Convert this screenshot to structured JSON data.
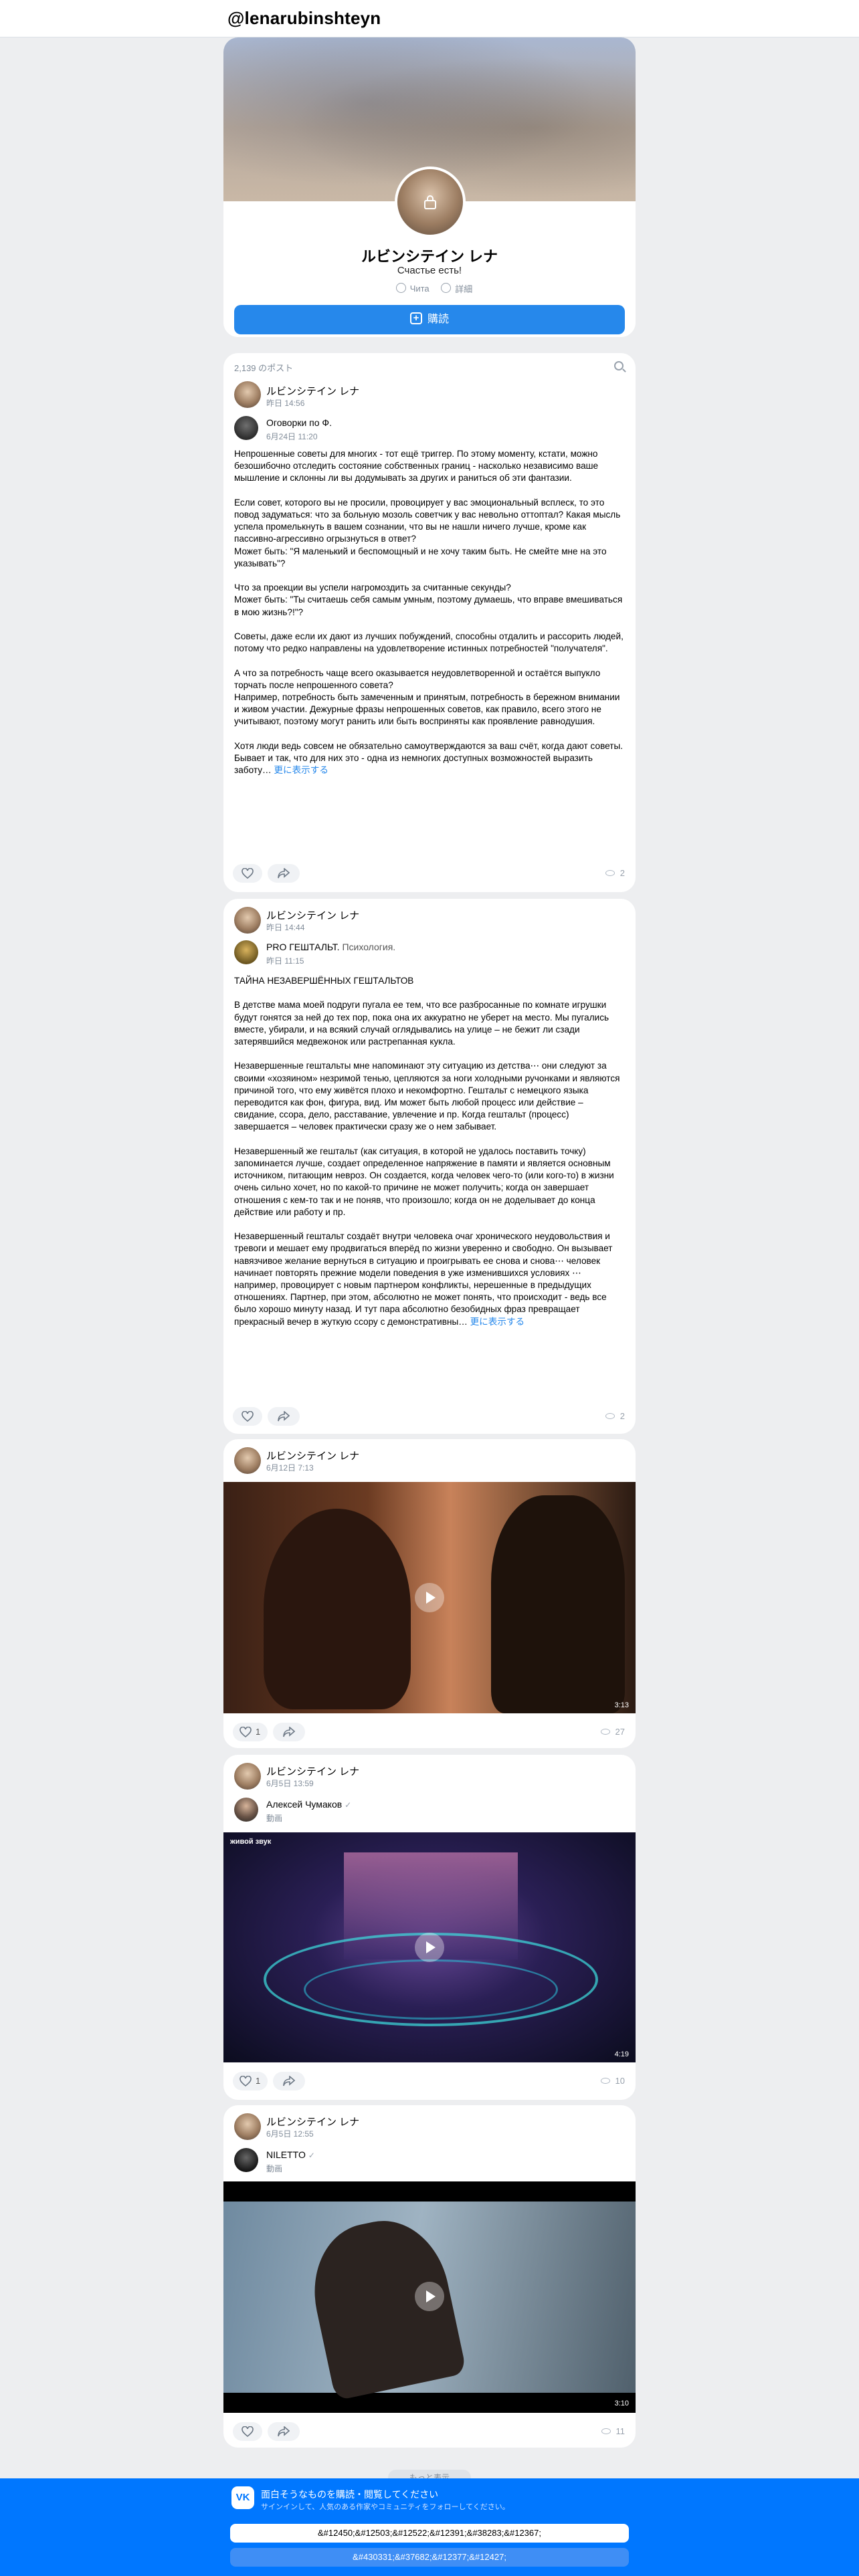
{
  "header": {
    "handle": "@lenarubinshteyn"
  },
  "profile": {
    "name": "ルビンシテイン レナ",
    "status": "Счастье есть!",
    "city": "Чита",
    "details": "詳細",
    "subscribe": "購読"
  },
  "wall": {
    "count": "2,139 のポスト"
  },
  "posts": [
    {
      "author": "ルビンシテイン レナ",
      "date": "昨日 14:56",
      "repost_name": "Оговорки по Ф.",
      "repost_date": "6月24日 11:20",
      "text": "Непрошенные советы для многих - тот ещё триггер. По этому моменту, кстати, можно безошибочно отследить состояние собственных границ - насколько независимо ваше мышление и склонны ли вы додумывать за других и раниться об эти фантазии.\n\nЕсли совет, которого вы не просили, провоцирует у вас эмоциональный всплеск, то это повод задуматься: что за больную мозоль советчик у вас невольно оттоптал? Какая мысль успела промелькнуть в вашем сознании, что вы не нашли ничего лучше, кроме как пассивно-агрессивно огрызнуться в ответ?\nМожет быть: \"Я маленький и беспомощный и не хочу таким быть. Не смейте мне на это указывать\"?\n\nЧто за проекции вы успели нагромоздить за считанные секунды?\nМожет быть: \"Ты считаешь себя самым умным, поэтому думаешь, что вправе вмешиваться в мою жизнь?!\"?\n\nСоветы, даже если их дают из лучших побуждений, способны отдалить и рассорить людей, потому что редко направлены на удовлетворение истинных потребностей \"получателя\".\n\nА что за потребность чаще всего оказывается неудовлетворенной и остаётся выпукло торчать после непрошенного совета?\nНапример, потребность быть замеченным и принятым, потребность в бережном внимании и живом участии. Дежурные фразы непрошенных советов, как правило, всего этого не учитывают, поэтому могут ранить или быть восприняты как проявление равнодушия.\n\nХотя люди ведь совсем не обязательно самоутверждаются за ваш счёт, когда дают советы. Бывает и так, что для них это - одна из немногих доступных возможностей выразить заботу…",
      "more": "更に表示する",
      "likes": "",
      "views": "2"
    },
    {
      "author": "ルビンシテイン レナ",
      "date": "昨日 14:44",
      "repost_name": "PRO ГЕШТАЛЬТ.",
      "repost_name2": "Психология.",
      "repost_date": "昨日 11:15",
      "text": "ТАЙНА НЕЗАВЕРШЁННЫХ ГЕШТАЛЬТОВ\n\nВ детстве мама моей подруги пугала ее тем, что все разбросанные по комнате игрушки будут гонятся за ней до тех пор, пока она их аккуратно не уберет на место. Мы пугались вместе, убирали, и на всякий случай оглядывались на улице – не бежит ли сзади затерявшийся медвежонок или растрепанная кукла.\n\nНезавершенные гештальты мне напоминают эту ситуацию из детства⋯ они следуют за своими «хозяином» незримой тенью, цепляются за ноги холодными ручонками и являются причиной того, что ему живётся плохо и некомфортно. Гештальт с немецкого языка переводится как фон, фигура, вид. Им может быть любой процесс или действие – свидание, ссора, дело, расставание, увлечение и пр. Когда гештальт (процесс) завершается – человек практически сразу же о нем забывает.\n\nНезавершенный же гештальт (как ситуация, в которой не удалось поставить точку) запоминается лучше, создает определенное напряжение в памяти и является основным источником, питающим невроз. Он создается, когда человек чего-то (или кого-то) в жизни очень сильно хочет, но по какой-то причине не может получить; когда он завершает отношения с кем-то так и не поняв, что произошло; когда он не доделывает до конца действие или работу и пр.\n\nНезавершенный гештальт создаёт внутри человека очаг хронического неудовольствия и тревоги и мешает ему продвигаться вперёд по жизни уверенно и свободно. Он вызывает навязчивое желание вернуться в ситуацию и проигрывать ее снова и снова⋯ человек начинает повторять прежние модели поведения в уже изменившихся условиях ⋯ например, провоцирует с новым партнером конфликты, нерешенные в предыдущих отношениях. Партнер, при этом, абсолютно не может понять, что происходит - ведь все было хорошо минуту назад. И тут пара абсолютно безобидных фраз превращает прекрасный вечер в жуткую ссору с демонстративны…",
      "more": "更に表示する",
      "likes": "",
      "views": "2"
    },
    {
      "author": "ルビンシテイン レナ",
      "date": "6月12日 7:13",
      "duration": "3:13",
      "likes": "1",
      "views": "27"
    },
    {
      "author": "ルビンシテイン レナ",
      "date": "6月5日 13:59",
      "repost_name": "Алексей Чумаков",
      "repost_sub": "動画",
      "video_caption": "живой звук",
      "duration": "4:19",
      "likes": "1",
      "views": "10"
    },
    {
      "author": "ルビンシテイン レナ",
      "date": "6月5日 12:55",
      "repost_name": "NILETTO",
      "repost_sub": "動画",
      "duration": "3:10",
      "likes": "",
      "views": "11"
    }
  ],
  "footer": {
    "show_more": "もっと表示",
    "title": "面白そうなものを購読・閲覧してください",
    "subtitle": "サインインして、人気のある作家やコミュニティをフォローしてください。",
    "btn1": "&#12450;&#12503;&#12522;&#12391;&#38283;&#12367;",
    "btn2": "&#430331;&#37682;&#12377;&#12427;"
  }
}
